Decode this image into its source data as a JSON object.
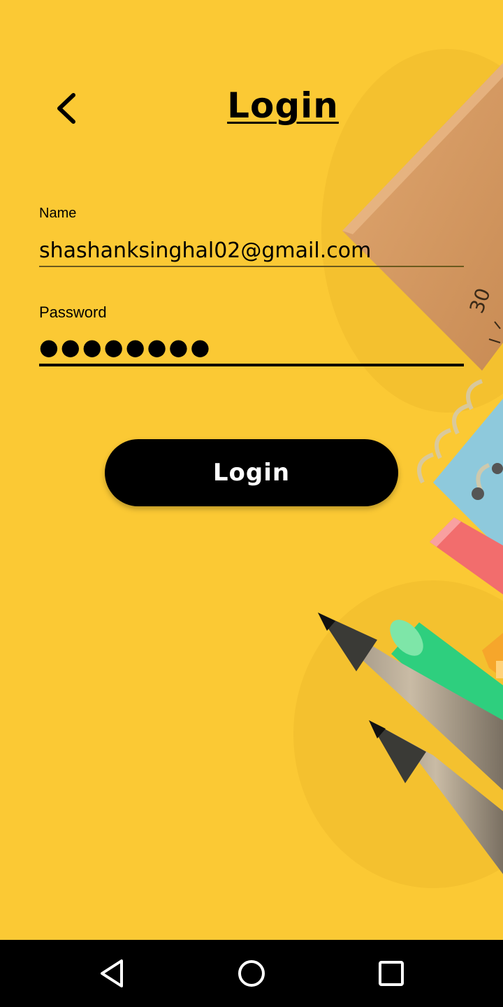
{
  "header": {
    "title": "Login",
    "back_icon": "chevron-left-icon"
  },
  "form": {
    "name_label": "Name",
    "name_value": "shashanksinghal02@gmail.com",
    "password_label": "Password",
    "password_masked": "●●●●●●●●"
  },
  "actions": {
    "login_label": "Login"
  },
  "nav_bar": {
    "back_icon": "triangle-back-icon",
    "home_icon": "circle-home-icon",
    "recents_icon": "square-recents-icon"
  },
  "colors": {
    "background": "#fbc934",
    "button": "#000000",
    "button_text": "#ffffff"
  }
}
